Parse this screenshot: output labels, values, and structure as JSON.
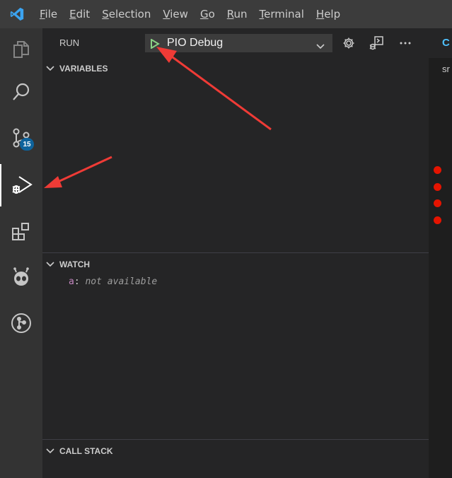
{
  "menu": {
    "items": [
      {
        "mnemonic": "F",
        "rest": "ile"
      },
      {
        "mnemonic": "E",
        "rest": "dit"
      },
      {
        "mnemonic": "S",
        "rest": "election"
      },
      {
        "mnemonic": "V",
        "rest": "iew"
      },
      {
        "mnemonic": "G",
        "rest": "o"
      },
      {
        "mnemonic": "R",
        "rest": "un"
      },
      {
        "mnemonic": "T",
        "rest": "erminal"
      },
      {
        "mnemonic": "H",
        "rest": "elp"
      }
    ]
  },
  "activity_bar": {
    "items": [
      "explorer-icon",
      "search-icon",
      "source-control-icon",
      "run-debug-icon",
      "extensions-icon",
      "platformio-icon",
      "git-graph-icon"
    ],
    "source_control_badge": "15",
    "active": "run-debug-icon"
  },
  "run_panel": {
    "title": "RUN",
    "config": "PIO Debug",
    "toolbar_icons": [
      "gear-icon",
      "debug-console-icon",
      "more-icon"
    ]
  },
  "sections": {
    "variables": "VARIABLES",
    "watch": "WATCH",
    "call_stack": "CALL STACK"
  },
  "watch": {
    "expressions": [
      {
        "name": "a",
        "separator": ":",
        "value": "not available"
      }
    ]
  },
  "editor": {
    "tab_label": "C",
    "breadcrumb": "sr",
    "breakpoint_count": 4
  },
  "colors": {
    "accent_play": "#89d185",
    "badge": "#0e639c",
    "breakpoint": "#e51400",
    "annotation_arrow": "#ef3b36"
  }
}
